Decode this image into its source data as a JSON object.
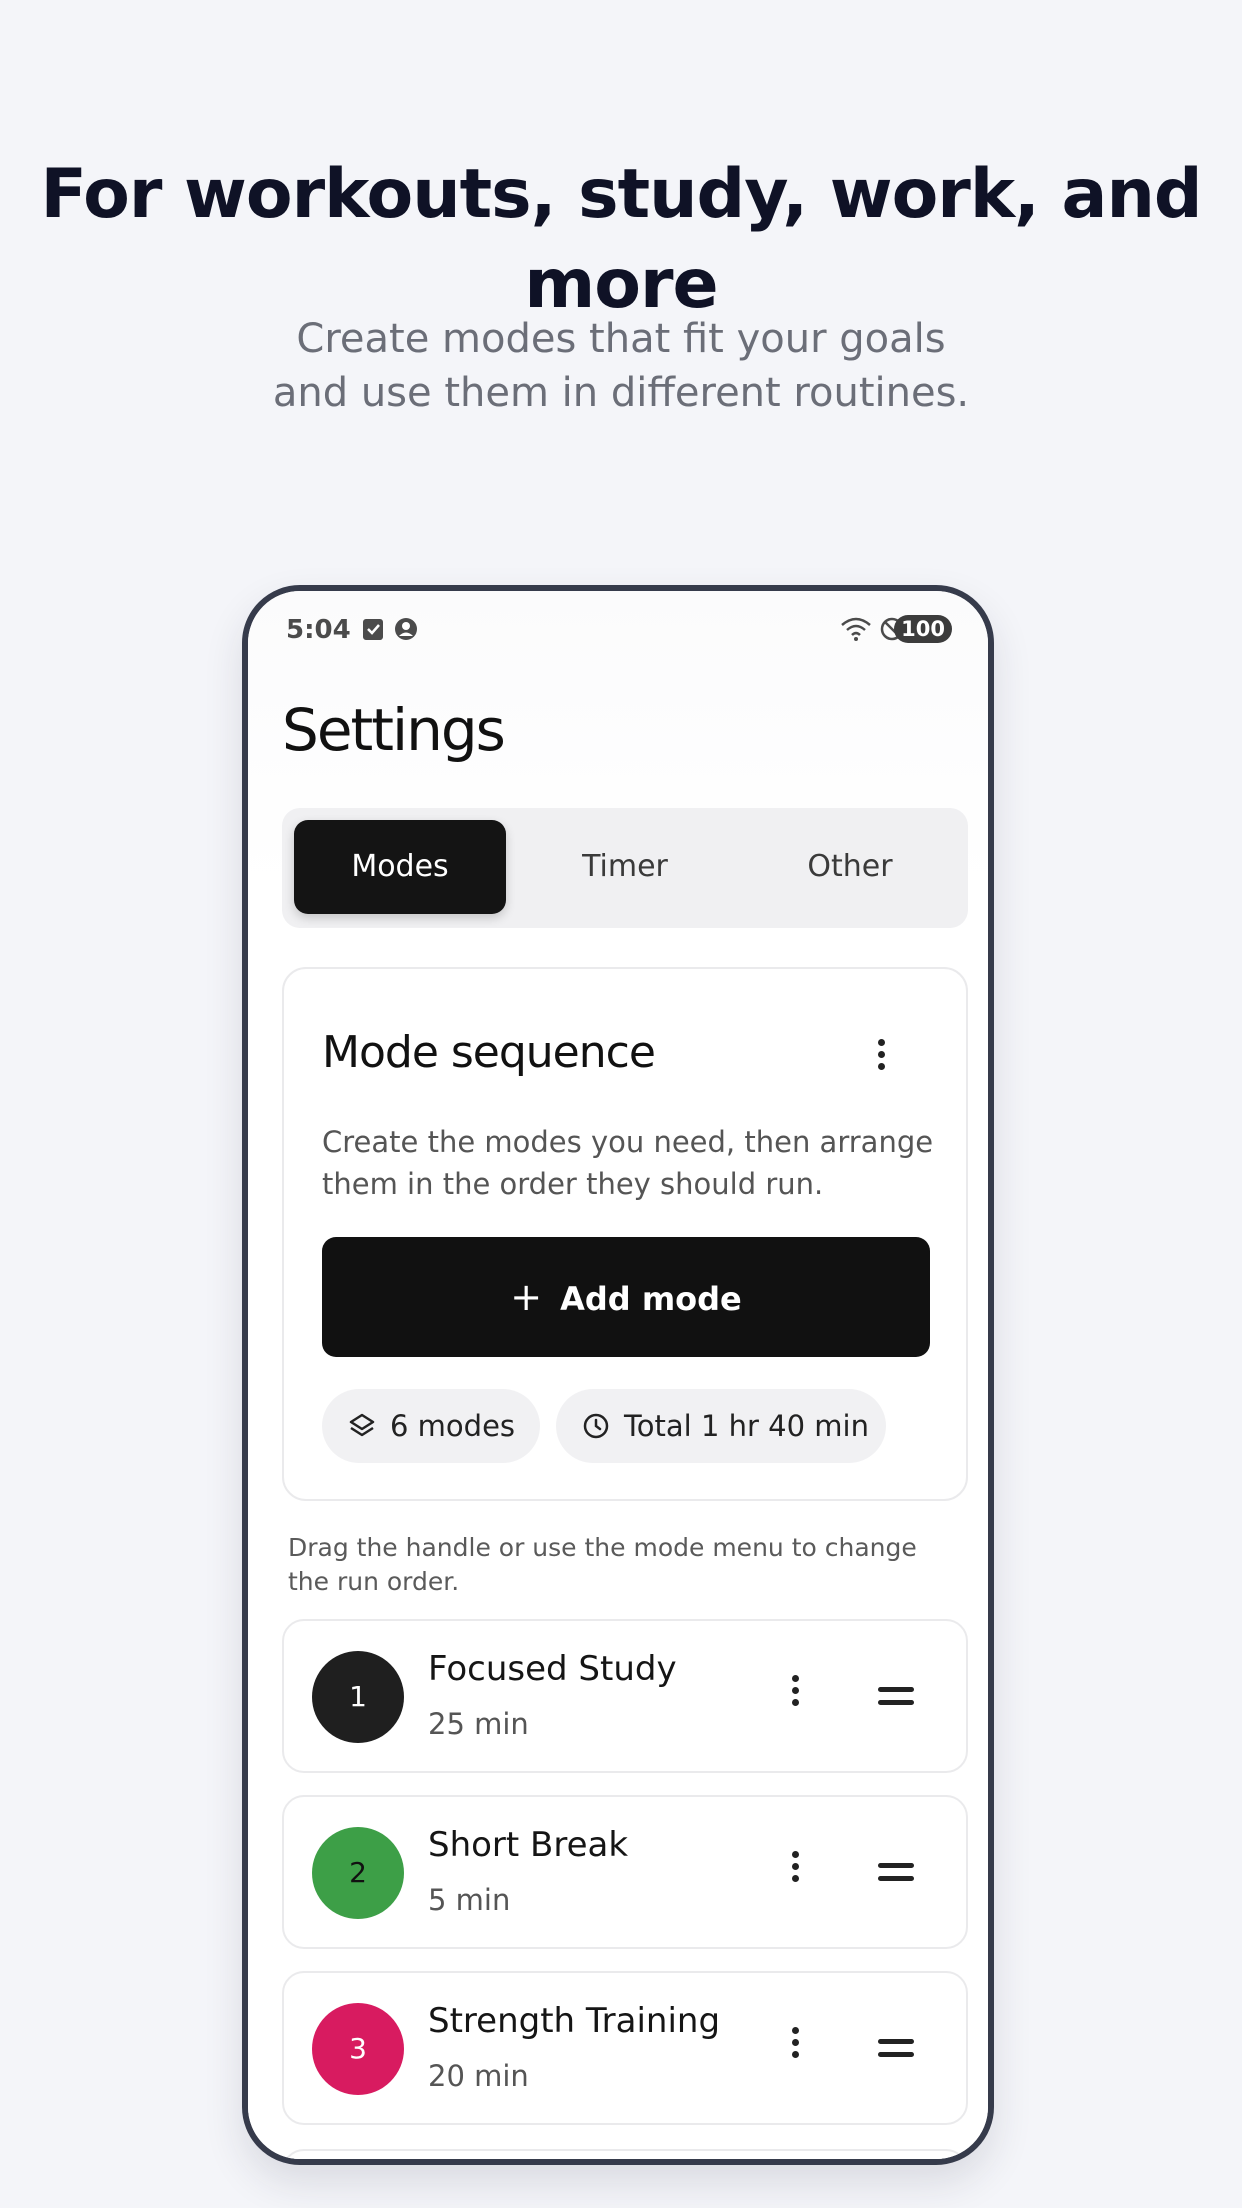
{
  "promo": {
    "headline": "For workouts, study, work, and more",
    "subline_1": "Create modes that fit your goals",
    "subline_2": "and use them in different routines."
  },
  "status_bar": {
    "time": "5:04",
    "battery": "100"
  },
  "screen": {
    "title": "Settings",
    "tabs": [
      {
        "label": "Modes",
        "active": true
      },
      {
        "label": "Timer",
        "active": false
      },
      {
        "label": "Other",
        "active": false
      }
    ]
  },
  "mode_card": {
    "title": "Mode sequence",
    "description": "Create the modes you need, then arrange them in the order they should run.",
    "add_button": "Add mode",
    "modes_chip": "6 modes",
    "total_chip": "Total 1 hr 40 min"
  },
  "hint": "Drag the handle or use the mode menu to change the run order.",
  "modes": [
    {
      "index": "1",
      "name": "Focused Study",
      "duration": "25 min",
      "color": "#1f1f1f"
    },
    {
      "index": "2",
      "name": "Short Break",
      "duration": "5 min",
      "color": "#3d9f47"
    },
    {
      "index": "3",
      "name": "Strength Training",
      "duration": "20 min",
      "color": "#d81b60"
    }
  ]
}
